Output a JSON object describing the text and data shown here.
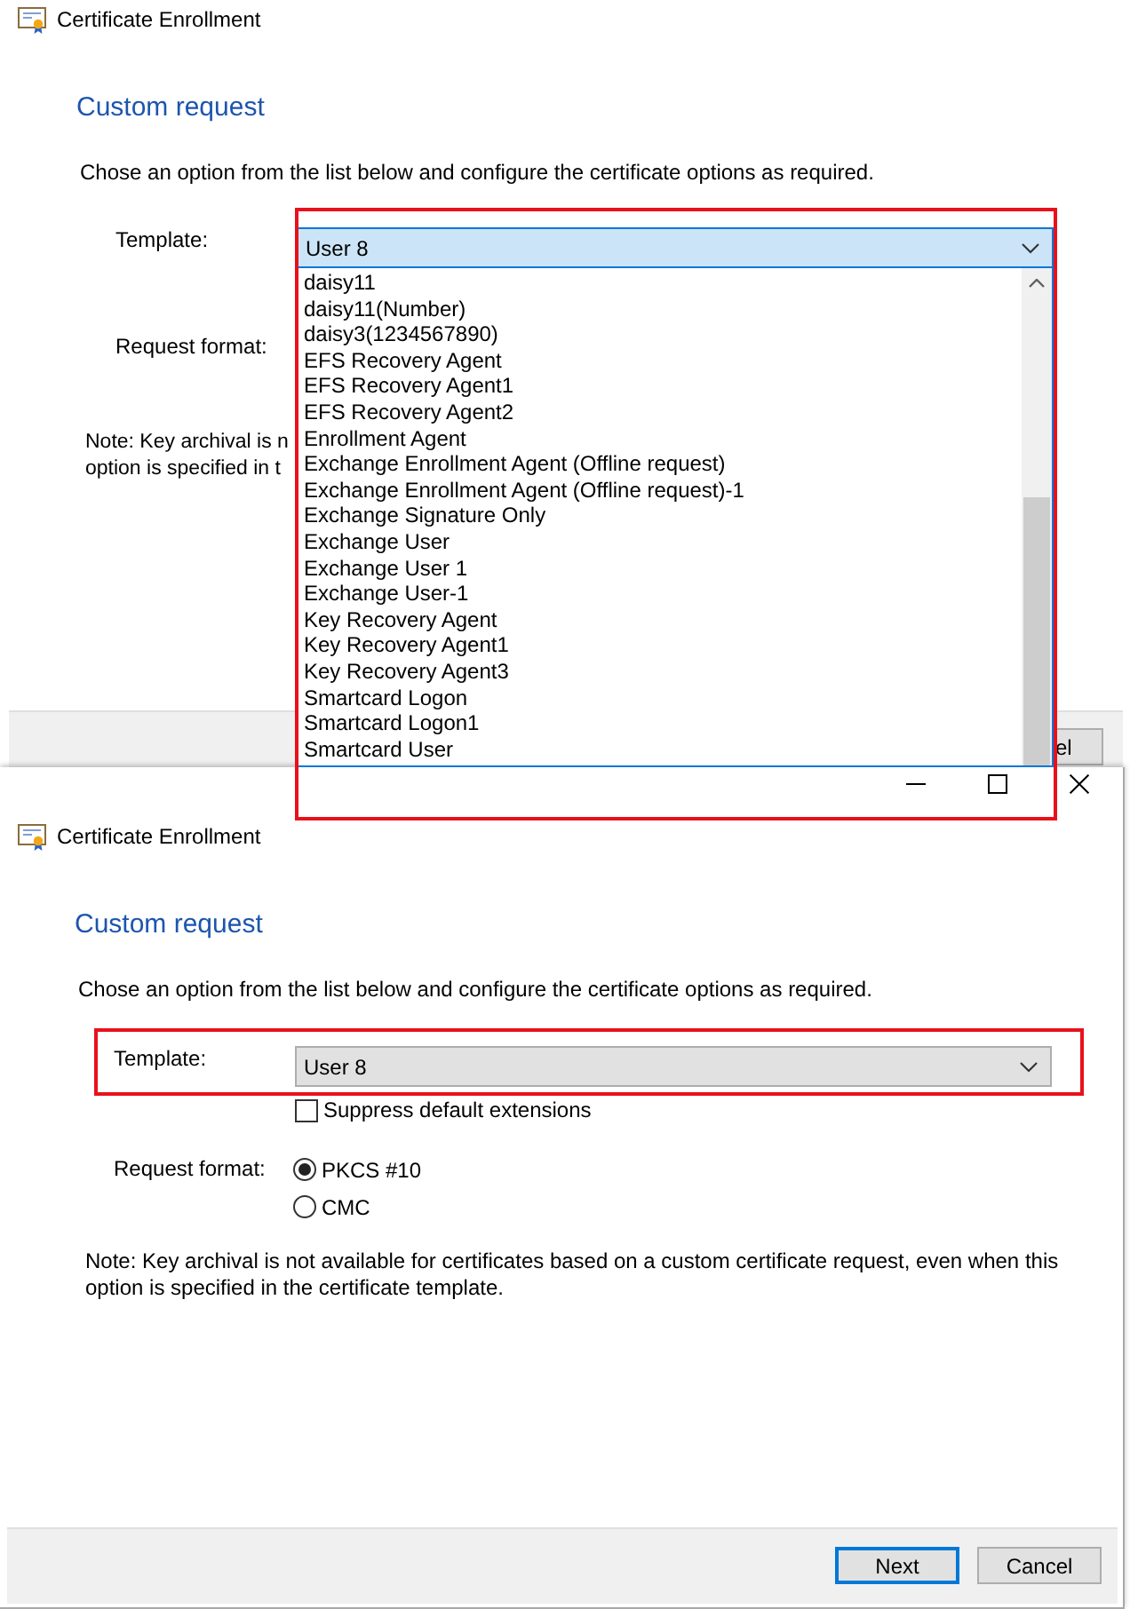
{
  "back_window": {
    "title": "Certificate Enrollment",
    "heading": "Custom request",
    "instruction": "Chose an option from the list below and configure the certificate options as required.",
    "template": {
      "label": "Template:",
      "value": "User 8",
      "expanded": true,
      "highlighted": true
    },
    "template_options": [
      "daisy11",
      "daisy11(Number)",
      "daisy3(1234567890)",
      "EFS Recovery Agent",
      "EFS Recovery Agent1",
      "EFS Recovery Agent2",
      "Enrollment Agent",
      "Exchange Enrollment Agent (Offline request)",
      "Exchange Enrollment Agent (Offline request)-1",
      "Exchange Signature Only",
      "Exchange User",
      "Exchange User 1",
      "Exchange User-1",
      "Key Recovery Agent",
      "Key Recovery Agent1",
      "Key Recovery Agent3",
      "Smartcard Logon",
      "Smartcard Logon1",
      "Smartcard User"
    ],
    "request_format_label": "Request format:",
    "note_lines": [
      "Note: Key archival is n",
      "option is specified in t"
    ],
    "buttons": [
      {
        "label": "el",
        "kind": "secondary"
      }
    ]
  },
  "front_window": {
    "title": "Certificate Enrollment",
    "heading": "Custom request",
    "instruction": "Chose an option from the list below and configure the certificate options as required.",
    "template": {
      "label": "Template:",
      "value": "User 8",
      "expanded": false,
      "highlighted": true
    },
    "suppress_extensions": {
      "label": "Suppress default extensions",
      "checked": false
    },
    "request_format": {
      "label": "Request format:",
      "options": [
        {
          "label": "PKCS #10",
          "selected": true
        },
        {
          "label": "CMC",
          "selected": false
        }
      ]
    },
    "note_lines": [
      "Note: Key archival is not available for certificates based on a custom certificate request, even when this",
      "option is specified in the certificate template."
    ],
    "buttons": [
      {
        "label": "Next",
        "kind": "primary"
      },
      {
        "label": "Cancel",
        "kind": "secondary"
      }
    ]
  }
}
